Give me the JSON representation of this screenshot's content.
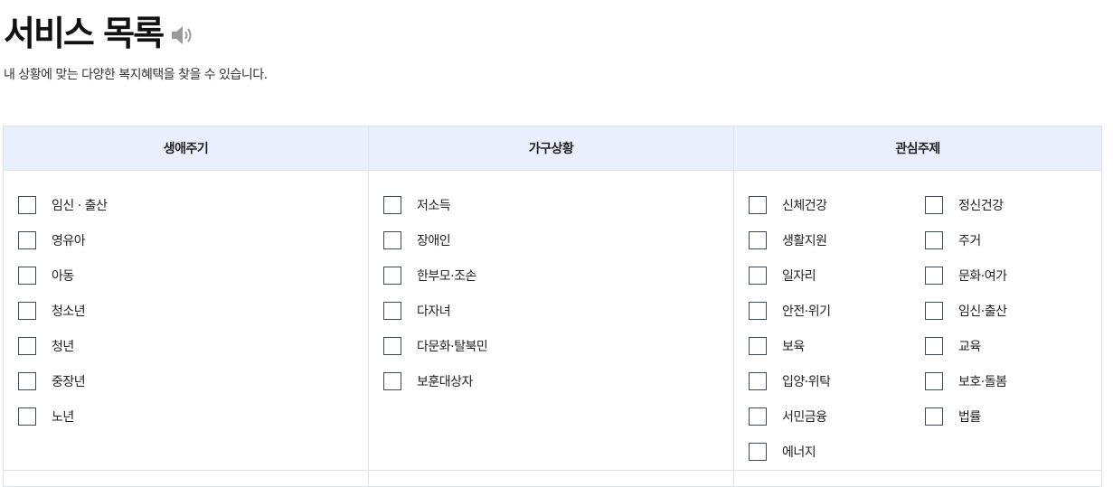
{
  "page": {
    "title": "서비스 목록",
    "subtitle": "내 상황에 맞는 다양한 복지혜택을 찾을 수 있습니다."
  },
  "columns": {
    "life": {
      "header": "생애주기",
      "items": [
        "임신 · 출산",
        "영유아",
        "아동",
        "청소년",
        "청년",
        "중장년",
        "노년"
      ]
    },
    "household": {
      "header": "가구상황",
      "items": [
        "저소득",
        "장애인",
        "한부모·조손",
        "다자녀",
        "다문화·탈북민",
        "보훈대상자"
      ]
    },
    "interest": {
      "header": "관심주제",
      "items_left": [
        "신체건강",
        "생활지원",
        "일자리",
        "안전·위기",
        "보육",
        "입양·위탁",
        "서민금융",
        "에너지"
      ],
      "items_right": [
        "정신건강",
        "주거",
        "문화·여가",
        "임신·출산",
        "교육",
        "보호·돌봄",
        "법률"
      ]
    }
  },
  "icons": {
    "speaker": "speaker-icon"
  },
  "colors": {
    "header_bg": "#e9effc",
    "border": "#dde1ea",
    "checkbox_border": "#3e4a5c"
  }
}
